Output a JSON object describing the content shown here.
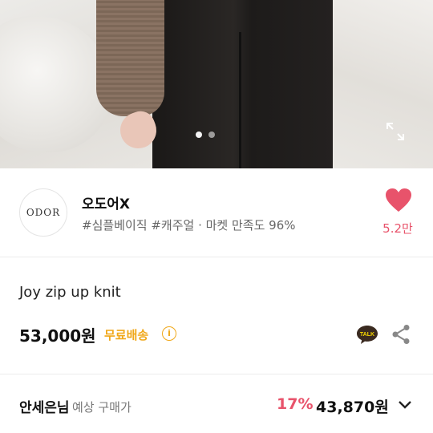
{
  "gallery": {
    "pages": 2,
    "active_index": 0
  },
  "store": {
    "logo_text": "ODOR",
    "name": "오도어X",
    "tags": "#심플베이직 #캐주얼 · 마켓 만족도 96%",
    "likes": "5.2만"
  },
  "product": {
    "name": "Joy zip up knit",
    "price": "53,000원",
    "shipping": "무료배송",
    "info_symbol": "i",
    "talk_label": "TALK"
  },
  "member_price": {
    "label": "안세은님",
    "sub": "예상 구매가",
    "discount": "17%",
    "price": "43,870원"
  },
  "colors": {
    "accent_pink": "#e8536b",
    "shipping_yellow": "#f0a81a",
    "kakao_yellow": "#f7d700"
  }
}
